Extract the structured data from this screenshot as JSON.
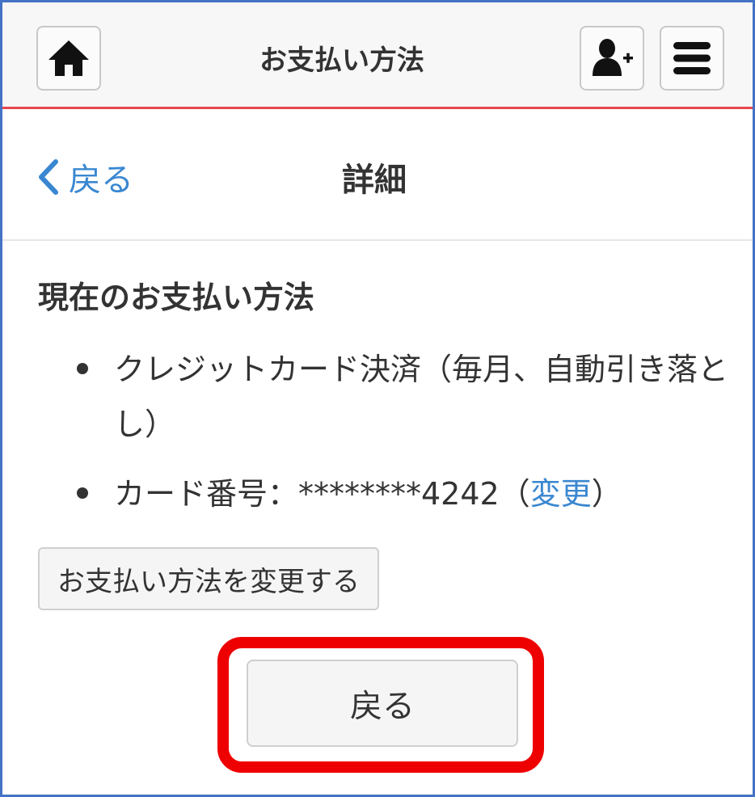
{
  "header": {
    "title": "お支払い方法",
    "home_icon": "home-icon",
    "user_add_icon": "user-add-icon",
    "menu_icon": "hamburger-menu-icon",
    "accent_color": "#e8474f"
  },
  "subheader": {
    "back_label": "戻る",
    "title": "詳細",
    "link_color": "#3a87d1"
  },
  "main": {
    "section_title": "現在のお支払い方法",
    "items": [
      {
        "text": "クレジットカード決済（毎月、自動引き落とし）"
      },
      {
        "prefix": "カード番号：********4242",
        "open_paren": "（",
        "link": "変更",
        "close_paren": "）"
      }
    ],
    "change_button_label": "お支払い方法を変更する",
    "back_button_label": "戻る",
    "highlight_color": "#ee0000"
  }
}
